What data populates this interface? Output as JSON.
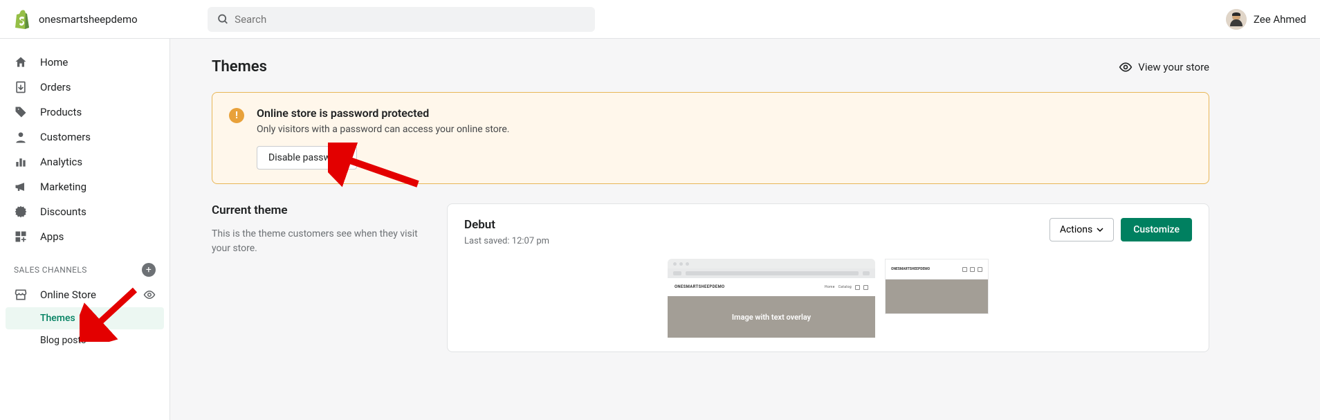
{
  "topbar": {
    "store_name": "onesmartsheepdemo",
    "search_placeholder": "Search",
    "user_name": "Zee Ahmed"
  },
  "sidebar": {
    "items": [
      {
        "label": "Home",
        "icon": "home"
      },
      {
        "label": "Orders",
        "icon": "orders"
      },
      {
        "label": "Products",
        "icon": "products"
      },
      {
        "label": "Customers",
        "icon": "customers"
      },
      {
        "label": "Analytics",
        "icon": "analytics"
      },
      {
        "label": "Marketing",
        "icon": "marketing"
      },
      {
        "label": "Discounts",
        "icon": "discounts"
      },
      {
        "label": "Apps",
        "icon": "apps"
      }
    ],
    "section_label": "SALES CHANNELS",
    "online_store": "Online Store",
    "sub": [
      {
        "label": "Themes",
        "selected": true
      },
      {
        "label": "Blog posts",
        "selected": false
      }
    ]
  },
  "page": {
    "title": "Themes",
    "view_store": "View your store"
  },
  "banner": {
    "title": "Online store is password protected",
    "text": "Only visitors with a password can access your online store.",
    "button": "Disable password"
  },
  "current": {
    "heading": "Current theme",
    "desc": "This is the theme customers see when they visit your store."
  },
  "theme": {
    "name": "Debut",
    "saved": "Last saved: 12:07 pm",
    "actions_label": "Actions",
    "customize_label": "Customize",
    "preview_brand_desktop": "ONESMARTSHEEPDEMO",
    "preview_brand_mobile": "ONESMARTSHEEPDEMO",
    "preview_nav1": "Home",
    "preview_nav2": "Catalog",
    "hero_text": "Image with text overlay"
  }
}
